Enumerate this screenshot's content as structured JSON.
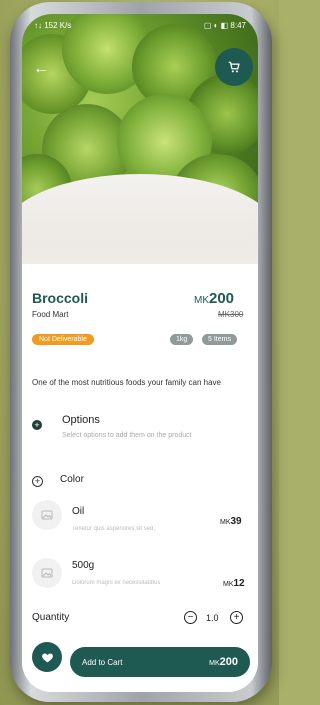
{
  "status_bar": {
    "left": "↑↓ 152 K/s",
    "right": "▢ ◐ ◧ 8:47"
  },
  "hero": {
    "back_icon": "back-arrow-icon",
    "cart_icon": "cart-icon"
  },
  "product": {
    "name": "Broccoli",
    "store": "Food Mart",
    "currency": "MK",
    "price": "200",
    "old_price": "MK300",
    "delivery_badge": "Not Deliverable",
    "weight_chip": "1kg",
    "items_chip": "5 Items",
    "description": "One of the most nutritious foods your family can have"
  },
  "options": {
    "title": "Options",
    "subtitle": "Select options to add them on the product"
  },
  "color_section": {
    "title": "Color",
    "items": [
      {
        "name": "Oil",
        "description": "Tenetur quis asperiores sit sed.",
        "currency": "MK",
        "price": "39"
      },
      {
        "name": "500g",
        "description": "Dolorum magni ex necessitatibus",
        "currency": "MK",
        "price": "12"
      }
    ]
  },
  "quantity": {
    "label": "Quantity",
    "value": "1.0",
    "minus": "−",
    "plus": "+"
  },
  "cta": {
    "label": "Add to Cart",
    "currency": "MK",
    "price": "200"
  },
  "colors": {
    "brand": "#1f5a52",
    "warning": "#f29c1f",
    "chip": "#8f9a99"
  }
}
